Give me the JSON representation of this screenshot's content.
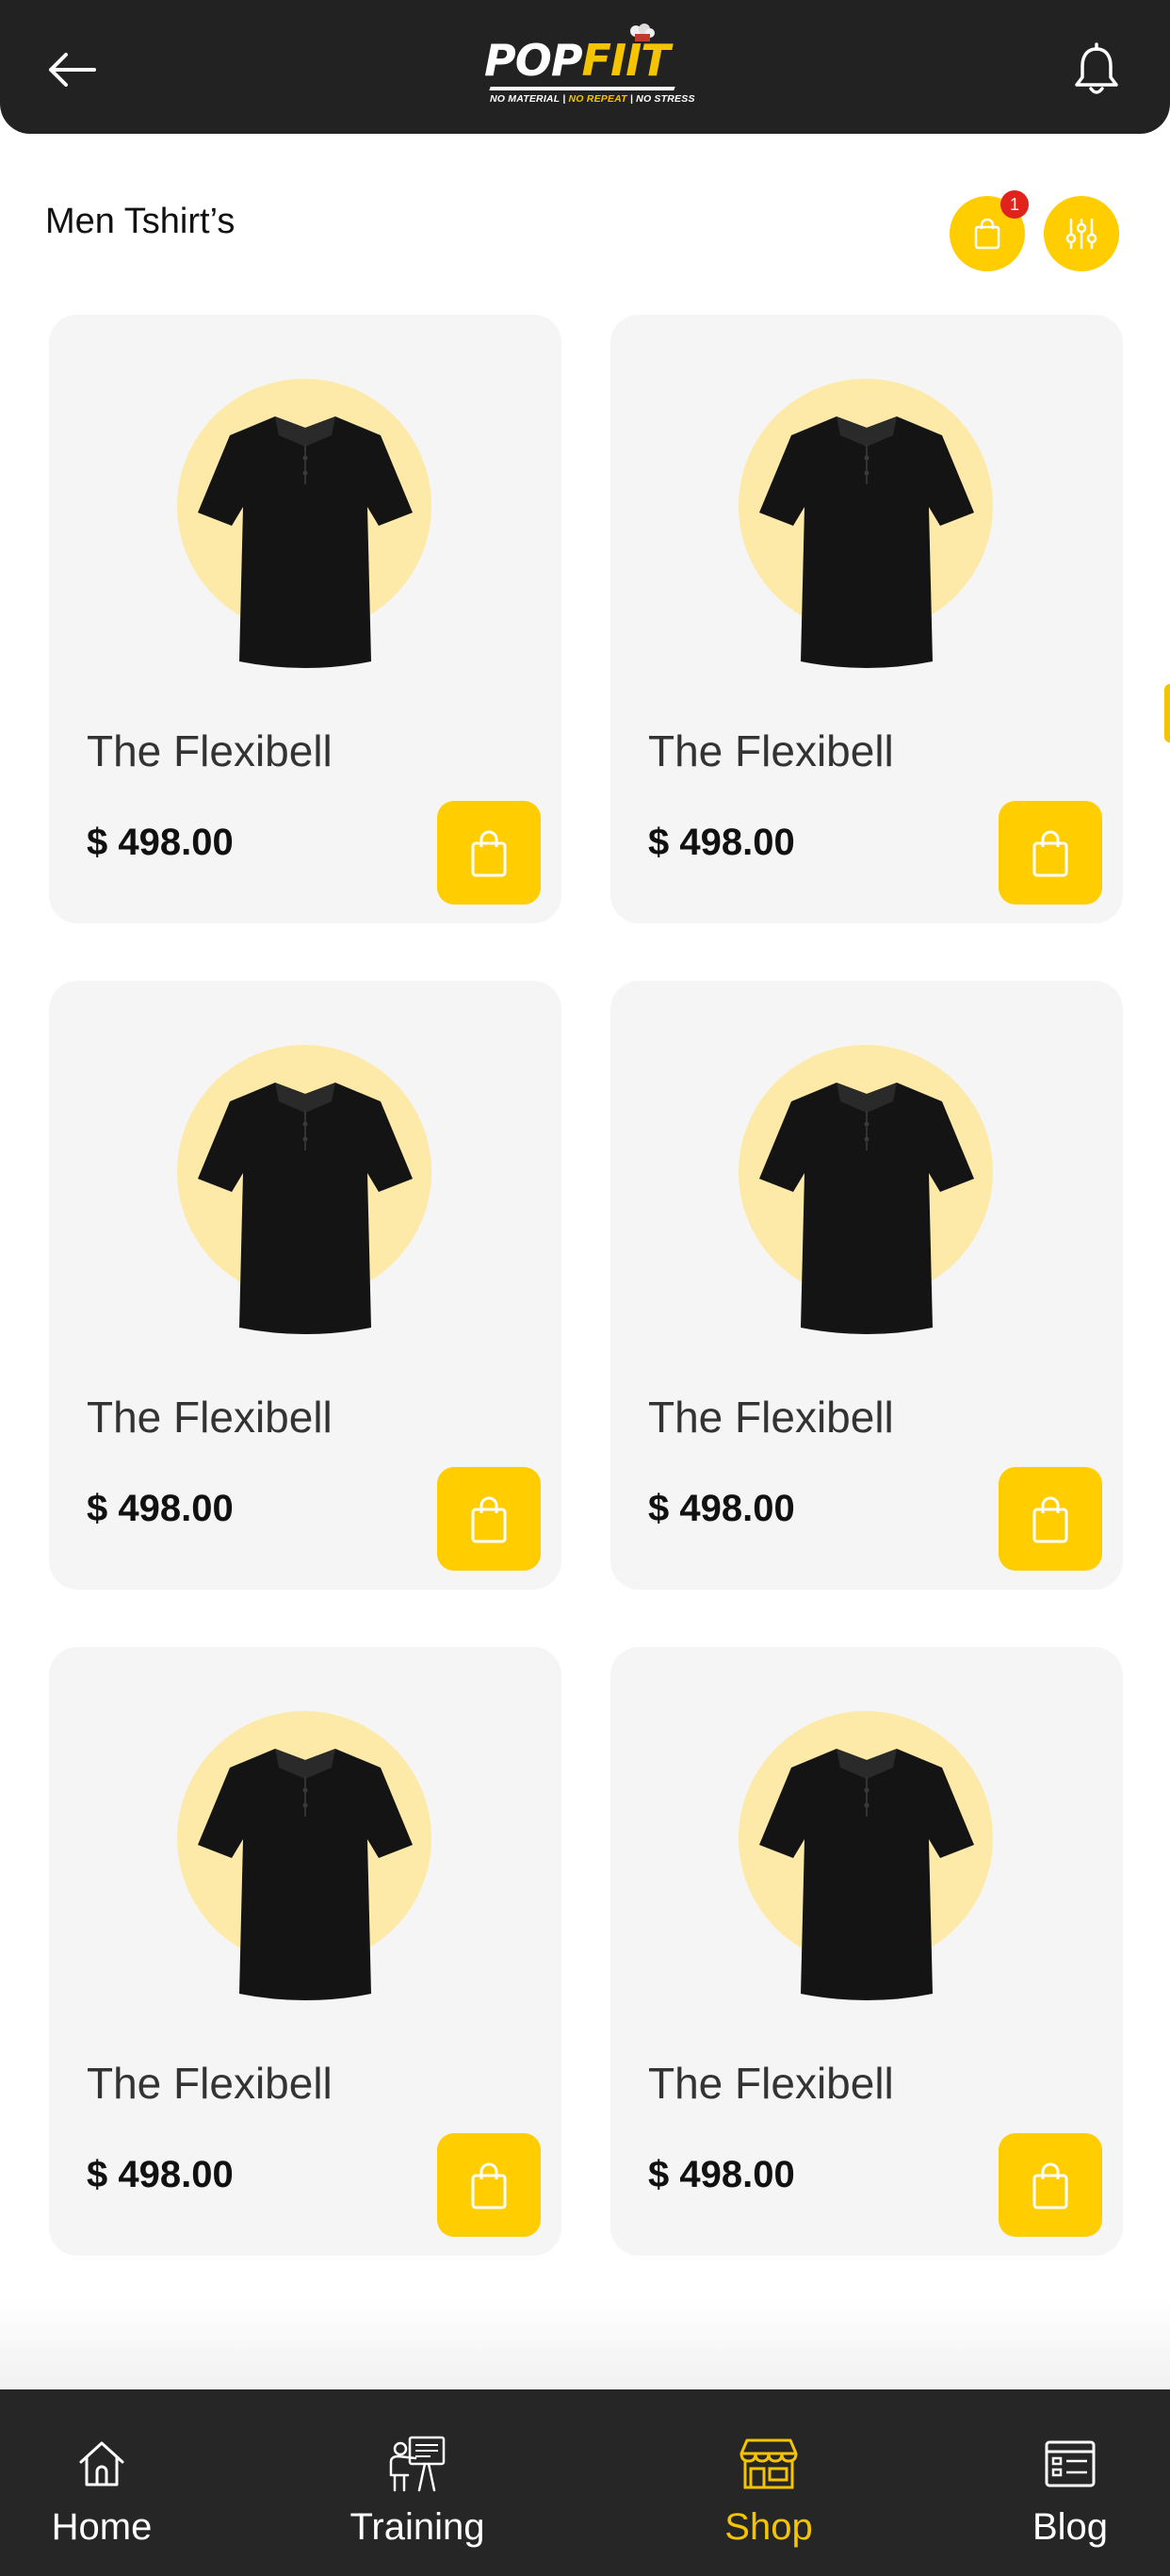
{
  "header": {
    "logo": {
      "pop": "POP",
      "fit": "FIIT",
      "tagline_1": "NO MATERIAL | ",
      "tagline_2": "NO REPEAT",
      "tagline_3": " | NO STRESS"
    },
    "back_icon": "arrow-left-icon",
    "notification_icon": "bell-icon"
  },
  "section": {
    "title": "Men Tshirt’s",
    "cart_badge": "1",
    "cart_icon": "shopping-bag-icon",
    "filter_icon": "sliders-icon"
  },
  "products": [
    {
      "name": "The Flexibell",
      "price": "$ 498.00"
    },
    {
      "name": "The Flexibell",
      "price": "$ 498.00"
    },
    {
      "name": "The Flexibell",
      "price": "$ 498.00"
    },
    {
      "name": "The Flexibell",
      "price": "$ 498.00"
    },
    {
      "name": "The Flexibell",
      "price": "$ 498.00"
    },
    {
      "name": "The Flexibell",
      "price": "$ 498.00"
    }
  ],
  "nav": {
    "items": [
      {
        "label": "Home",
        "icon": "home-icon",
        "active": false
      },
      {
        "label": "Training",
        "icon": "trainer-icon",
        "active": false
      },
      {
        "label": "Shop",
        "icon": "shop-icon",
        "active": true
      },
      {
        "label": "Blog",
        "icon": "blog-icon",
        "active": false
      }
    ]
  },
  "colors": {
    "accent": "#ffcd00",
    "header_bg": "#222222",
    "card_bg": "#f5f5f5",
    "badge": "#e0241b"
  }
}
